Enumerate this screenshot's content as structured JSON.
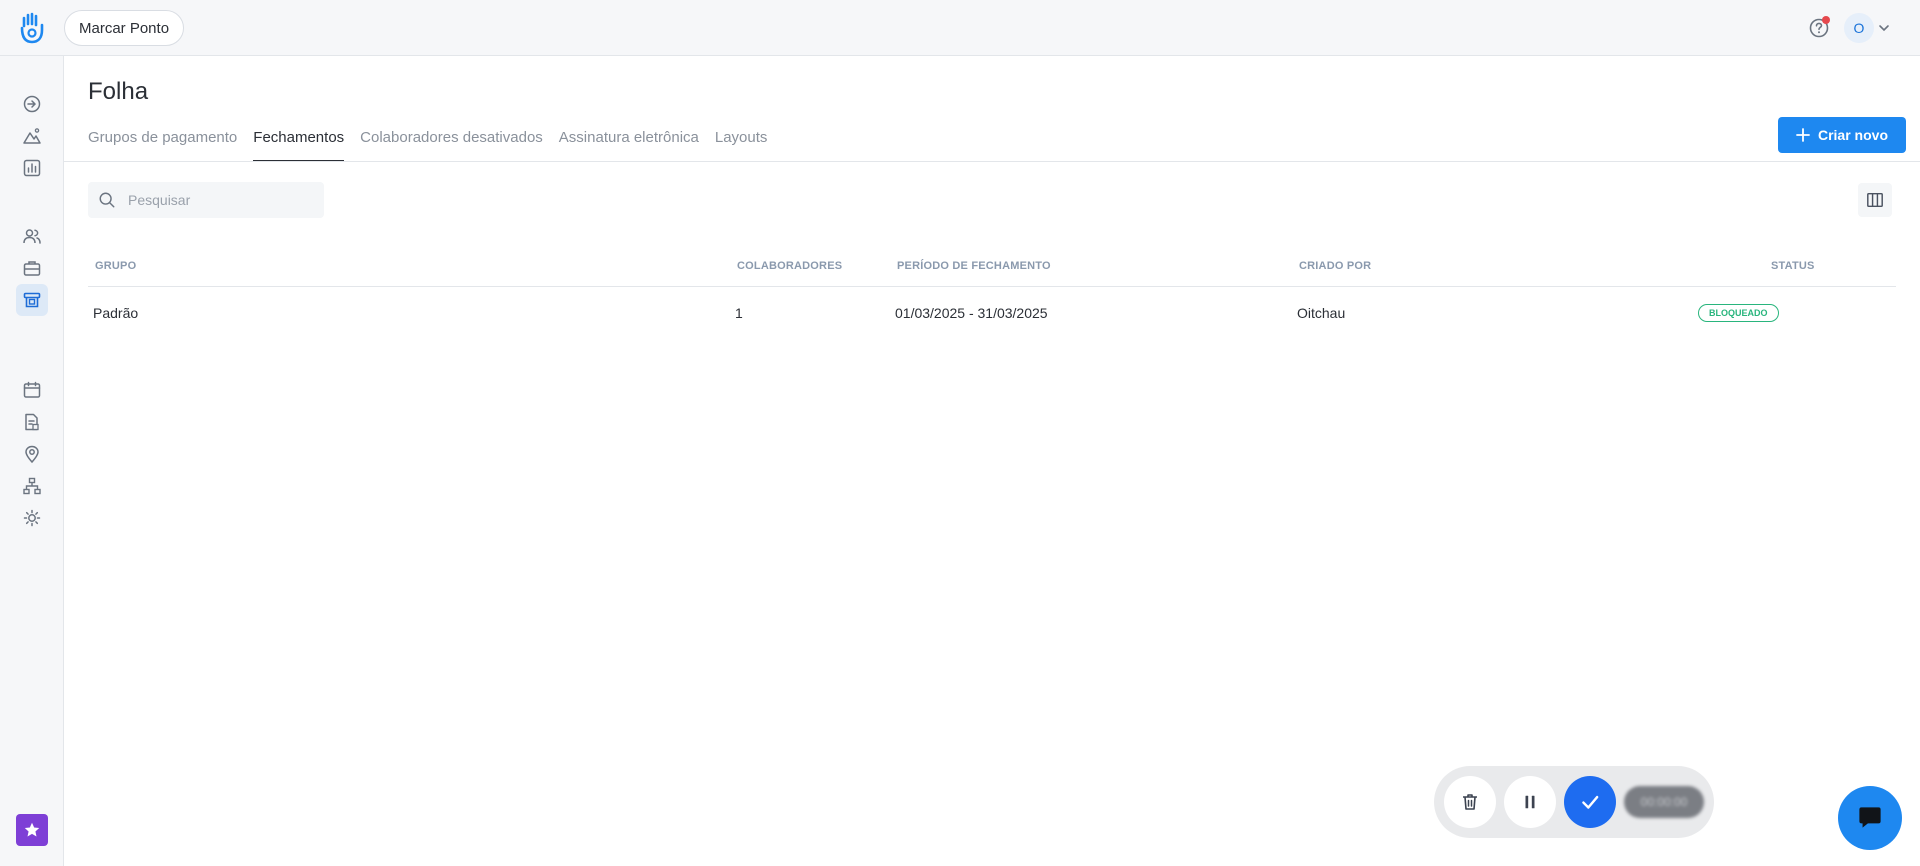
{
  "header": {
    "marcar_ponto_label": "Marcar Ponto",
    "avatar_initial": "O",
    "logo_icon": "hand-logo-icon",
    "help_icon": "help-circle-icon"
  },
  "sidebar": {
    "items": [
      {
        "icon": "login-arrow-icon"
      },
      {
        "icon": "mountain-icon"
      },
      {
        "icon": "bar-chart-icon"
      },
      {
        "icon": "users-icon"
      },
      {
        "icon": "briefcase-icon"
      },
      {
        "icon": "payroll-icon",
        "active": true
      },
      {
        "icon": "calendar-icon"
      },
      {
        "icon": "document-icon"
      },
      {
        "icon": "location-pin-icon"
      },
      {
        "icon": "org-chart-icon"
      },
      {
        "icon": "sun-icon"
      }
    ],
    "favorite_icon": "star-icon"
  },
  "page": {
    "title": "Folha",
    "tabs": [
      {
        "label": "Grupos de pagamento",
        "active": false
      },
      {
        "label": "Fechamentos",
        "active": true
      },
      {
        "label": "Colaboradores desativados",
        "active": false
      },
      {
        "label": "Assinatura eletrônica",
        "active": false
      },
      {
        "label": "Layouts",
        "active": false
      }
    ],
    "create_button_label": "Criar novo"
  },
  "search": {
    "placeholder": "Pesquisar",
    "value": ""
  },
  "table": {
    "columns": [
      "GRUPO",
      "COLABORADORES",
      "PERÍODO DE FECHAMENTO",
      "CRIADO POR",
      "STATUS"
    ],
    "rows": [
      {
        "grupo": "Padrão",
        "colaboradores": "1",
        "periodo": "01/03/2025 - 31/03/2025",
        "criado_por": "Oitchau",
        "status": "BLOQUEADO"
      }
    ]
  },
  "timer": {
    "time": "00:00:00"
  },
  "colors": {
    "primary": "#1e88f0",
    "status_green": "#29b57d",
    "favorite_purple": "#7e3fd6"
  }
}
